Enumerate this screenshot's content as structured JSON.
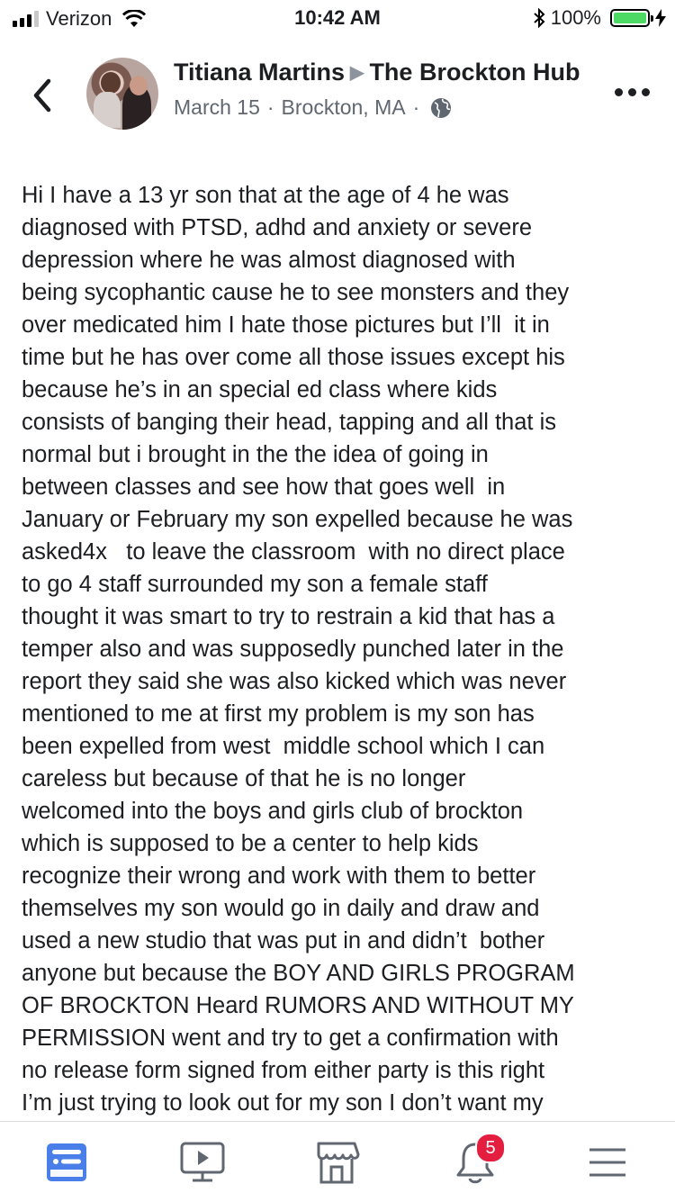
{
  "status_bar": {
    "carrier": "Verizon",
    "time": "10:42 AM",
    "battery_percent": "100%",
    "signal_bars_filled": 3,
    "signal_bars_total": 4
  },
  "header": {
    "author": "Titiana Martins",
    "group": "The Brockton Hub",
    "date": "March 15",
    "location": "Brockton, MA",
    "separator": "·",
    "privacy_icon": "globe-icon"
  },
  "post": {
    "text": "Hi I have a 13 yr son that at the age of 4 he was\ndiagnosed with PTSD, adhd and anxiety or severe\ndepression where he was almost diagnosed with\nbeing sycophantic cause he to see monsters and they\nover medicated him I hate those pictures but I’ll  it in\ntime but he has over come all those issues except his\nbecause he’s in an special ed class where kids\nconsists of banging their head, tapping and all that is\nnormal but i brought in the the idea of going in\nbetween classes and see how that goes well  in\nJanuary or February my son expelled because he was\nasked4x   to leave the classroom  with no direct place\nto go 4 staff surrounded my son a female staff\nthought it was smart to try to restrain a kid that has a\ntemper also and was supposedly punched later in the\nreport they said she was also kicked which was never\nmentioned to me at first my problem is my son has\nbeen expelled from west  middle school which I can\ncareless but because of that he is no longer\nwelcomed into the boys and girls club of brockton\nwhich is supposed to be a center to help kids\nrecognize their wrong and work with them to better\nthemselves my son would go in daily and draw and\nused a new studio that was put in and didn’t  bother\nanyone but because the BOY AND GIRLS PROGRAM\nOF BROCKTON Heard RUMORS AND WITHOUT MY\nPERMISSION went and try to get a confirmation with\nno release form signed from either party is this right\nI’m just trying to look out for my son I don’t want my"
  },
  "tab_bar": {
    "tabs": [
      {
        "icon": "news-feed-icon",
        "active": true
      },
      {
        "icon": "watch-video-icon",
        "active": false
      },
      {
        "icon": "marketplace-icon",
        "active": false
      },
      {
        "icon": "notifications-bell-icon",
        "active": false,
        "badge": "5"
      },
      {
        "icon": "menu-icon",
        "active": false
      }
    ],
    "active_color": "#4a7ee8",
    "inactive_color": "#606770"
  }
}
